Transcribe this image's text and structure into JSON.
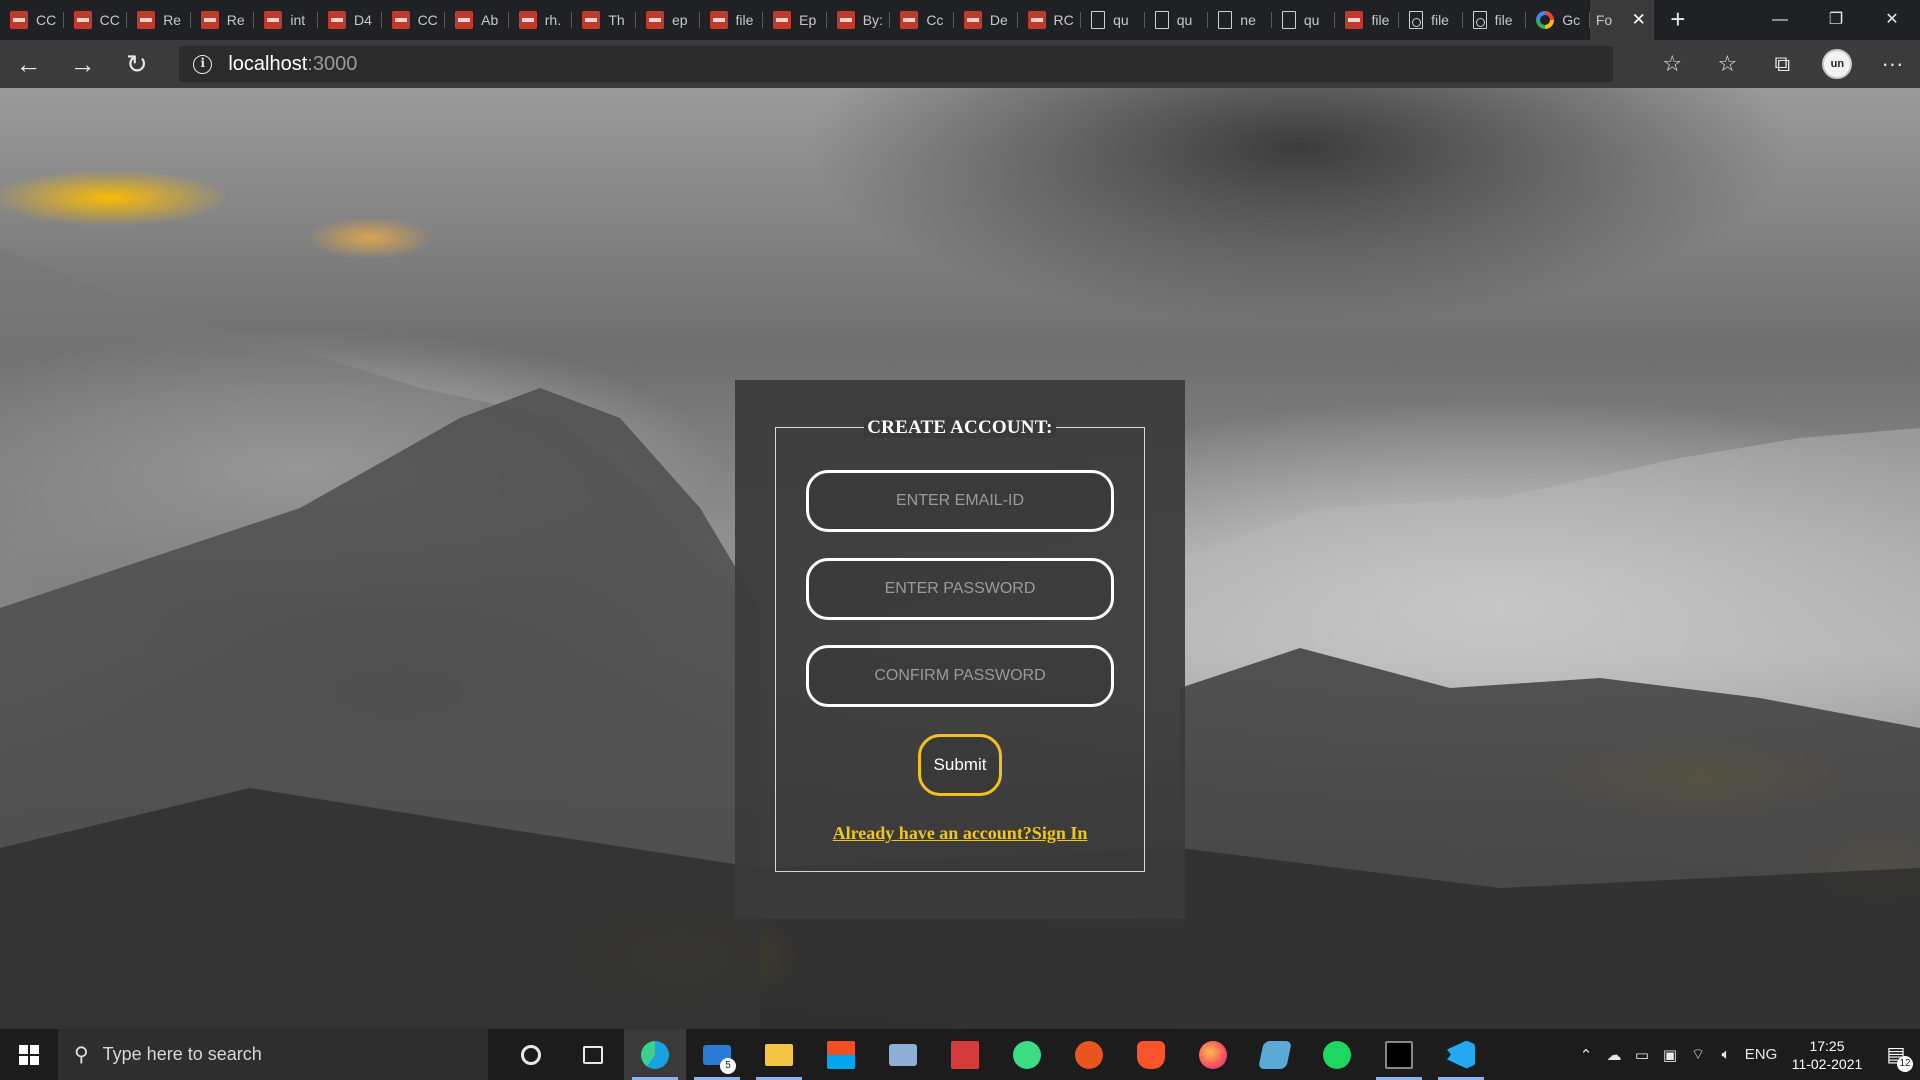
{
  "browser": {
    "tabs": [
      {
        "icon": "pdf-icon",
        "label": "CC"
      },
      {
        "icon": "pdf-icon",
        "label": "CC"
      },
      {
        "icon": "pdf-icon",
        "label": "Re"
      },
      {
        "icon": "pdf-icon",
        "label": "Re"
      },
      {
        "icon": "pdf-icon",
        "label": "int"
      },
      {
        "icon": "pdf-icon",
        "label": "D4"
      },
      {
        "icon": "pdf-icon",
        "label": "CC"
      },
      {
        "icon": "pdf-icon",
        "label": "Ab"
      },
      {
        "icon": "pdf-icon",
        "label": "rh."
      },
      {
        "icon": "pdf-icon",
        "label": "Th"
      },
      {
        "icon": "pdf-icon",
        "label": "ep"
      },
      {
        "icon": "pdf-icon",
        "label": "file"
      },
      {
        "icon": "pdf-icon",
        "label": "Ep"
      },
      {
        "icon": "pdf-icon",
        "label": "By:"
      },
      {
        "icon": "pdf-icon",
        "label": "Cc"
      },
      {
        "icon": "pdf-icon",
        "label": "De"
      },
      {
        "icon": "pdf-icon",
        "label": "RC"
      },
      {
        "icon": "document-icon",
        "label": "qu"
      },
      {
        "icon": "document-icon",
        "label": "qu"
      },
      {
        "icon": "document-icon",
        "label": "ne"
      },
      {
        "icon": "document-icon",
        "label": "qu"
      },
      {
        "icon": "pdf-icon",
        "label": "file"
      },
      {
        "icon": "blocked-file-icon",
        "label": "file"
      },
      {
        "icon": "blocked-file-icon",
        "label": "file"
      },
      {
        "icon": "google-icon",
        "label": "Gc"
      }
    ],
    "active_tab": {
      "label": "Fo",
      "close": "✕"
    },
    "new_tab": "+",
    "window_controls": {
      "minimize": "—",
      "restore": "❐",
      "close": "✕"
    },
    "address": {
      "host": "localhost",
      "port": ":3000"
    },
    "nav": {
      "back": "←",
      "forward": "→",
      "reload": "↻"
    },
    "toolbar": {
      "favorite_add": "☆",
      "favorites": "☆",
      "collections": "⧉",
      "profile_text": "un",
      "more": "···"
    }
  },
  "form": {
    "legend": "CREATE ACCOUNT:",
    "email_placeholder": "ENTER EMAIL-ID",
    "password_placeholder": "ENTER PASSWORD",
    "confirm_placeholder": "CONFIRM PASSWORD",
    "submit_label": "Submit",
    "signin_link": "Already have an account?Sign In"
  },
  "colors": {
    "accent_yellow": "#f2c516",
    "card_bg": "#3a3a3a",
    "taskbar_bg": "#1c1c1c"
  },
  "taskbar": {
    "search_placeholder": "Type here to search",
    "apps": [
      {
        "name": "cortana-icon"
      },
      {
        "name": "task-view-icon"
      },
      {
        "name": "edge-icon"
      },
      {
        "name": "mail-icon",
        "badge": "5"
      },
      {
        "name": "file-explorer-icon"
      },
      {
        "name": "store-icon"
      },
      {
        "name": "vm-icon"
      },
      {
        "name": "gift-icon"
      },
      {
        "name": "android-studio-icon"
      },
      {
        "name": "ubuntu-icon"
      },
      {
        "name": "brave-icon"
      },
      {
        "name": "firefox-icon"
      },
      {
        "name": "virtualbox-icon"
      },
      {
        "name": "spotify-icon"
      },
      {
        "name": "terminal-icon"
      },
      {
        "name": "vscode-icon"
      }
    ],
    "tray": {
      "language": "ENG",
      "time": "17:25",
      "date": "11-02-2021",
      "notifications": "12"
    }
  }
}
